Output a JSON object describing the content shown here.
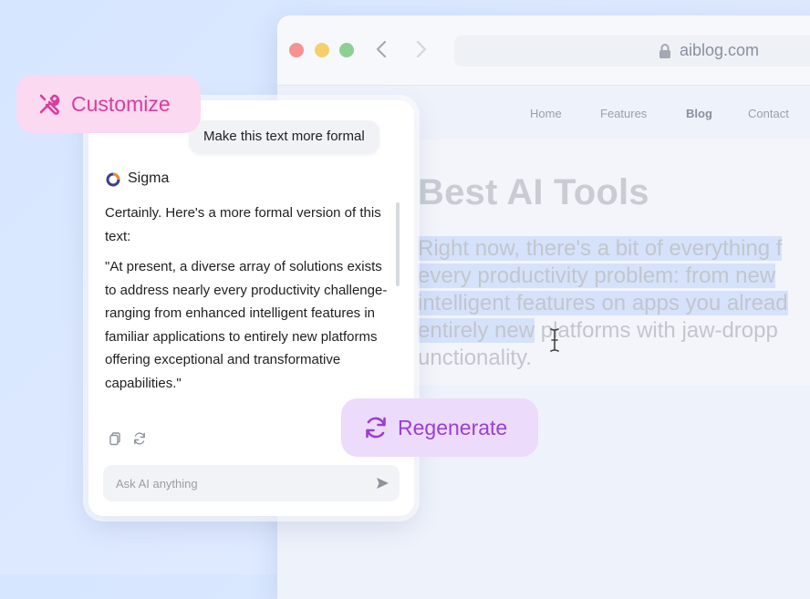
{
  "browser": {
    "url": "aiblog.com",
    "nav": [
      "Home",
      "Features",
      "Blog",
      "Contact"
    ],
    "active_nav": "Blog"
  },
  "blog": {
    "title": "Best AI Tools",
    "lines": [
      "Right now, there's a bit of everything f",
      "every productivity problem: from new",
      "intelligent features on apps you alread",
      "entirely new",
      " platforms with jaw-dropp",
      "unctionality."
    ]
  },
  "chat": {
    "user_message": "Make this text more formal",
    "assistant_name": "Sigma",
    "reply_intro": "Certainly. Here's a more formal version of this text:",
    "reply_quote": "\"At present, a diverse array of solutions exists to address nearly every productivity challenge-ranging from enhanced intelligent features in familiar applications to entirely new platforms offering exceptional and transformative capabilities.\"",
    "input_placeholder": "Ask AI anything"
  },
  "pills": {
    "customize": "Customize",
    "regenerate": "Regenerate"
  },
  "colors": {
    "customize_accent": "#d93d9c",
    "regenerate_accent": "#9a3fd1",
    "highlight": "#d5e2fa"
  },
  "icons": [
    "close-dot",
    "minimize-dot",
    "maximize-dot",
    "back-arrow-icon",
    "forward-arrow-icon",
    "lock-icon",
    "sigma-logo-icon",
    "copy-icon",
    "refresh-icon",
    "send-icon",
    "tools-icon",
    "regenerate-icon",
    "text-cursor-icon"
  ]
}
